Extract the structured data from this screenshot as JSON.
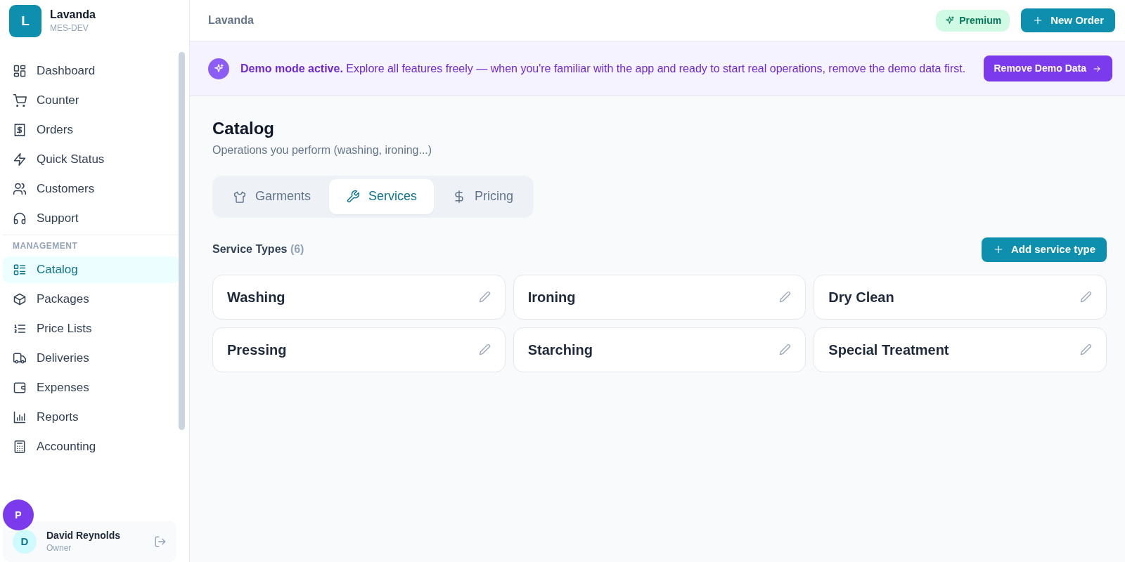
{
  "brand": {
    "logo": "L",
    "name": "Lavanda",
    "env": "MES-DEV"
  },
  "nav_sections": [
    {
      "items": [
        {
          "label": "Dashboard",
          "selected": false
        },
        {
          "label": "Counter",
          "selected": false
        },
        {
          "label": "Orders",
          "selected": false
        },
        {
          "label": "Quick Status",
          "selected": false
        },
        {
          "label": "Customers",
          "selected": false
        },
        {
          "label": "Support",
          "selected": false
        }
      ]
    },
    {
      "header": "MANAGEMENT",
      "items": [
        {
          "label": "Catalog",
          "selected": true
        },
        {
          "label": "Packages",
          "selected": false
        },
        {
          "label": "Price Lists",
          "selected": false
        },
        {
          "label": "Deliveries",
          "selected": false
        },
        {
          "label": "Expenses",
          "selected": false
        },
        {
          "label": "Reports",
          "selected": false
        },
        {
          "label": "Accounting",
          "selected": false
        }
      ]
    }
  ],
  "user": {
    "initial": "D",
    "name": "David Reynolds",
    "role": "Owner"
  },
  "floating_badge": "P",
  "topbar": {
    "title": "Lavanda",
    "premium": "Premium",
    "new_order": "New Order"
  },
  "banner": {
    "text": "**Demo mode active.** Explore all features freely — when you're familiar with the app and ready to start real operations, remove the demo data first.",
    "button": "Remove Demo Data"
  },
  "page": {
    "title": "Catalog",
    "subtitle": "Operations you perform (washing, ironing...)"
  },
  "tabs": [
    {
      "label": "Garments",
      "selected": false
    },
    {
      "label": "Services",
      "selected": true
    },
    {
      "label": "Pricing",
      "selected": false
    }
  ],
  "section": {
    "title": "Service Types",
    "count": "(6)",
    "add_button": "Add service type"
  },
  "services": [
    {
      "name": "Washing"
    },
    {
      "name": "Ironing"
    },
    {
      "name": "Dry Clean"
    },
    {
      "name": "Pressing"
    },
    {
      "name": "Starching"
    },
    {
      "name": "Special Treatment"
    }
  ]
}
